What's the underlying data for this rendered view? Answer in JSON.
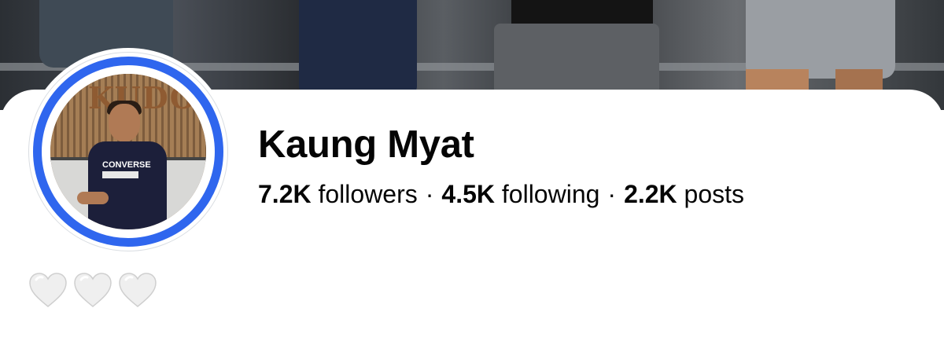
{
  "profile": {
    "name": "Kaung Myat",
    "avatar_sign_text": "KUDO",
    "shirt_text": "CONVERSE"
  },
  "stats": {
    "followers_count": "7.2K",
    "followers_label": "followers",
    "following_count": "4.5K",
    "following_label": "following",
    "posts_count": "2.2K",
    "posts_label": "posts",
    "separator": "·"
  },
  "reactions": {
    "hearts": [
      "white-heart-icon",
      "white-heart-icon",
      "white-heart-icon"
    ]
  },
  "colors": {
    "story_ring": "#2f66ee",
    "text": "#050505",
    "background": "#ffffff",
    "heart_fill": "#efefef",
    "heart_stroke": "#cfcfcf"
  }
}
